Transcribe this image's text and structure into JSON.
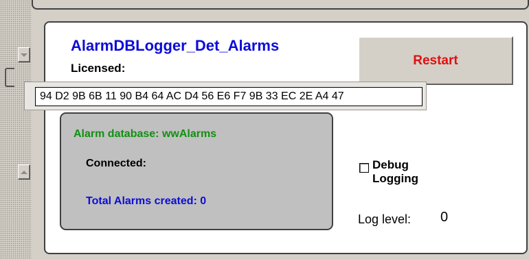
{
  "header": {
    "title": "AlarmDBLogger_Det_Alarms",
    "licensed_label": "Licensed:"
  },
  "license": {
    "key": "94 D2 9B 6B 11 90 B4 64 AC D4 56 E6 F7 9B 33 EC 2E A4 47"
  },
  "actions": {
    "restart_label": "Restart"
  },
  "database": {
    "name_label": "Alarm database: wwAlarms",
    "status_label": "Connected:",
    "total_label": "Total Alarms created: 0"
  },
  "debug": {
    "label_line1": "Debug",
    "label_line2": "Logging",
    "checked": false
  },
  "log": {
    "label": "Log level:",
    "value": "0"
  },
  "colors": {
    "title": "#0c0cd8",
    "restart": "#e01010",
    "database_name": "#119011",
    "total_alarms": "#0c0cd8"
  },
  "icons": {
    "scroll_up": "arrow-up-icon",
    "scroll_down": "arrow-down-icon"
  }
}
